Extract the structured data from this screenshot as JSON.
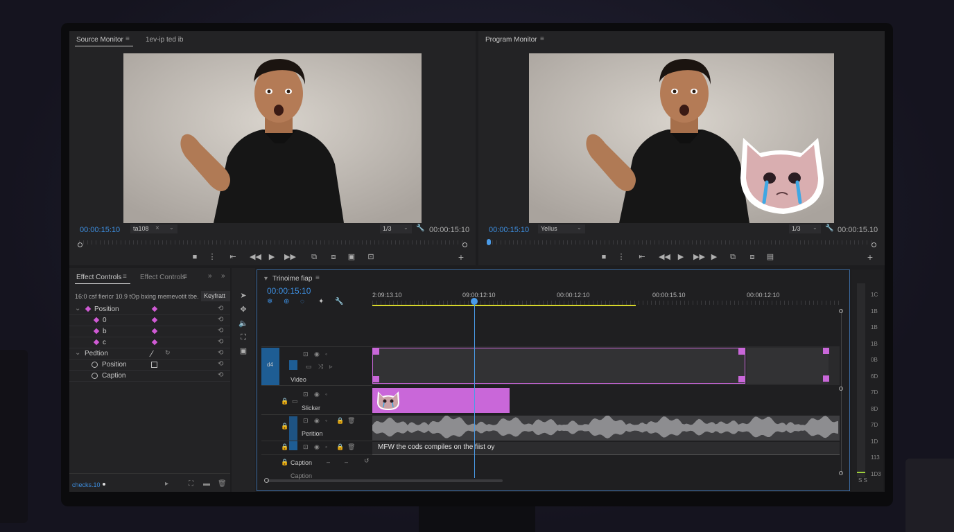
{
  "source_monitor": {
    "tab_label": "Source Monitor",
    "clip_name": "1ev-ip ted ib",
    "timecode_left": "00:00:15:10",
    "zoom_value": "ta108",
    "x_label": "×",
    "res_value": "1/3",
    "timecode_right": "00:00:15:10"
  },
  "program_monitor": {
    "tab_label": "Program Monitor",
    "timecode_left": "00:00:15:10",
    "zoom_value": "Yellus",
    "res_value": "1/3",
    "timecode_right": "00:00:15.10",
    "sticker_name": "crying-cat-sticker"
  },
  "effect_controls": {
    "tab1": "Effect Controls",
    "tab2": "Effect Controls",
    "header_text": "16:0 csf fiericr 10.9 tOp bxing memevotit tbe.",
    "keyframe_label": "Keyfratt",
    "rows": [
      {
        "label": "Position",
        "indent": 0,
        "kf": true
      },
      {
        "label": "0",
        "indent": 1,
        "kf": true
      },
      {
        "label": "b",
        "indent": 1,
        "kf": true
      },
      {
        "label": "c",
        "indent": 1,
        "kf": true
      },
      {
        "label": "Pedtion",
        "indent": 0,
        "kf": false
      },
      {
        "label": "Position",
        "indent": 1,
        "kf": false
      },
      {
        "label": "Caption",
        "indent": 1,
        "kf": false
      }
    ],
    "footer_timecode": "checks.10"
  },
  "timeline": {
    "tab_label": "Trinoime fiap",
    "timecode": "00:00:15:10",
    "ruler_labels": [
      "2:09:13.10",
      "09:00:12:10",
      "00:00:12:10",
      "00:00:15.10",
      "00:00:12:10"
    ],
    "tracks": [
      {
        "id": "v4",
        "label": "Video",
        "target": "d4"
      },
      {
        "id": "sticker",
        "label": "Slicker"
      },
      {
        "id": "a1",
        "label": "Perition"
      },
      {
        "id": "a2",
        "label": ""
      },
      {
        "id": "caption",
        "label": "Caption"
      },
      {
        "id": "caption2",
        "label": "Caption"
      }
    ],
    "caption_text": "MFW the cods compiles on the fiist oy"
  },
  "meter": {
    "scale": [
      "1C",
      "1B",
      "1B",
      "1B",
      "0B",
      "6D",
      "7D",
      "8D",
      "7D",
      "1D",
      "113",
      "1D3"
    ],
    "bottom": "S S"
  },
  "colors": {
    "accent": "#3d8ee0",
    "clip_pink": "#c967d9",
    "playhead": "#4a9be8"
  }
}
